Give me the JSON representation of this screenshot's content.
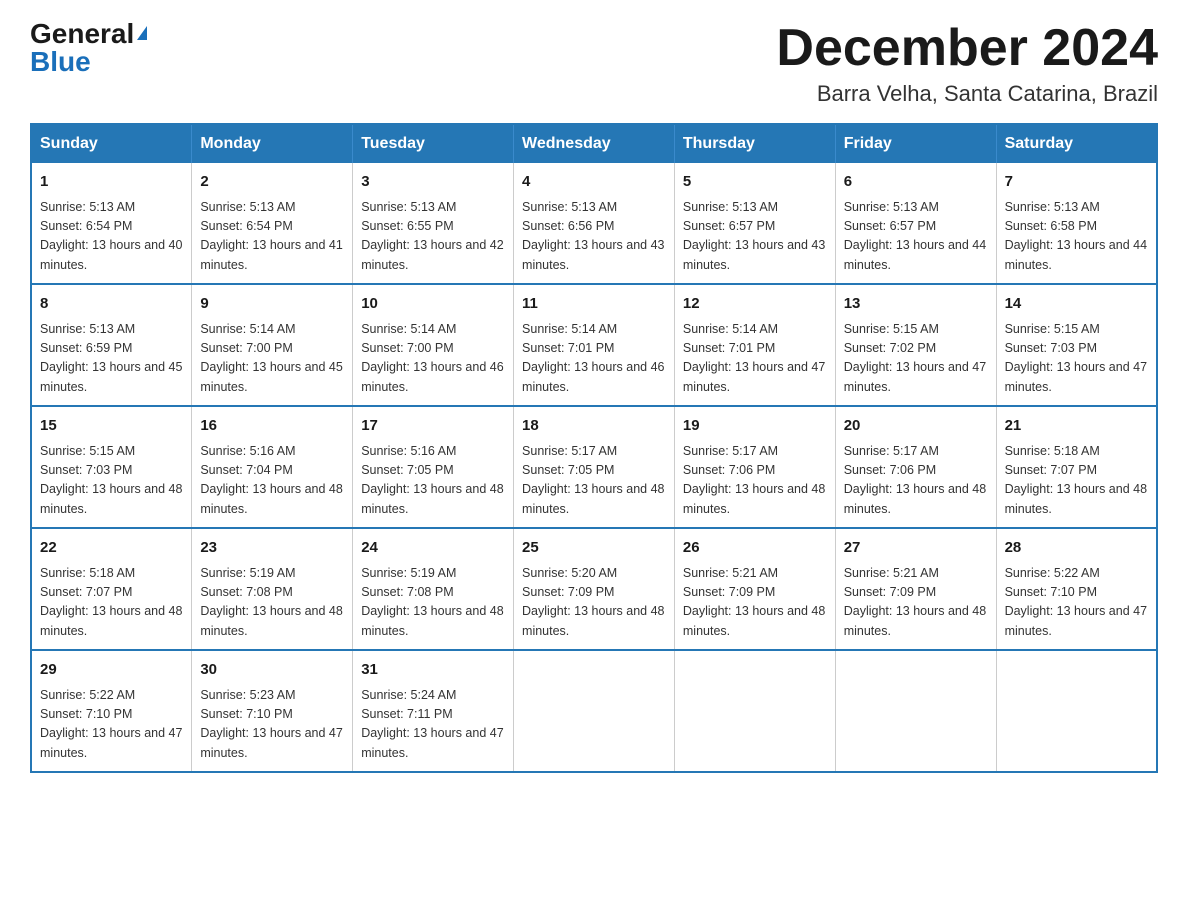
{
  "header": {
    "logo_general": "General",
    "logo_blue": "Blue",
    "month_title": "December 2024",
    "location": "Barra Velha, Santa Catarina, Brazil"
  },
  "days_of_week": [
    "Sunday",
    "Monday",
    "Tuesday",
    "Wednesday",
    "Thursday",
    "Friday",
    "Saturday"
  ],
  "weeks": [
    [
      {
        "day": "1",
        "sunrise": "5:13 AM",
        "sunset": "6:54 PM",
        "daylight": "13 hours and 40 minutes."
      },
      {
        "day": "2",
        "sunrise": "5:13 AM",
        "sunset": "6:54 PM",
        "daylight": "13 hours and 41 minutes."
      },
      {
        "day": "3",
        "sunrise": "5:13 AM",
        "sunset": "6:55 PM",
        "daylight": "13 hours and 42 minutes."
      },
      {
        "day": "4",
        "sunrise": "5:13 AM",
        "sunset": "6:56 PM",
        "daylight": "13 hours and 43 minutes."
      },
      {
        "day": "5",
        "sunrise": "5:13 AM",
        "sunset": "6:57 PM",
        "daylight": "13 hours and 43 minutes."
      },
      {
        "day": "6",
        "sunrise": "5:13 AM",
        "sunset": "6:57 PM",
        "daylight": "13 hours and 44 minutes."
      },
      {
        "day": "7",
        "sunrise": "5:13 AM",
        "sunset": "6:58 PM",
        "daylight": "13 hours and 44 minutes."
      }
    ],
    [
      {
        "day": "8",
        "sunrise": "5:13 AM",
        "sunset": "6:59 PM",
        "daylight": "13 hours and 45 minutes."
      },
      {
        "day": "9",
        "sunrise": "5:14 AM",
        "sunset": "7:00 PM",
        "daylight": "13 hours and 45 minutes."
      },
      {
        "day": "10",
        "sunrise": "5:14 AM",
        "sunset": "7:00 PM",
        "daylight": "13 hours and 46 minutes."
      },
      {
        "day": "11",
        "sunrise": "5:14 AM",
        "sunset": "7:01 PM",
        "daylight": "13 hours and 46 minutes."
      },
      {
        "day": "12",
        "sunrise": "5:14 AM",
        "sunset": "7:01 PM",
        "daylight": "13 hours and 47 minutes."
      },
      {
        "day": "13",
        "sunrise": "5:15 AM",
        "sunset": "7:02 PM",
        "daylight": "13 hours and 47 minutes."
      },
      {
        "day": "14",
        "sunrise": "5:15 AM",
        "sunset": "7:03 PM",
        "daylight": "13 hours and 47 minutes."
      }
    ],
    [
      {
        "day": "15",
        "sunrise": "5:15 AM",
        "sunset": "7:03 PM",
        "daylight": "13 hours and 48 minutes."
      },
      {
        "day": "16",
        "sunrise": "5:16 AM",
        "sunset": "7:04 PM",
        "daylight": "13 hours and 48 minutes."
      },
      {
        "day": "17",
        "sunrise": "5:16 AM",
        "sunset": "7:05 PM",
        "daylight": "13 hours and 48 minutes."
      },
      {
        "day": "18",
        "sunrise": "5:17 AM",
        "sunset": "7:05 PM",
        "daylight": "13 hours and 48 minutes."
      },
      {
        "day": "19",
        "sunrise": "5:17 AM",
        "sunset": "7:06 PM",
        "daylight": "13 hours and 48 minutes."
      },
      {
        "day": "20",
        "sunrise": "5:17 AM",
        "sunset": "7:06 PM",
        "daylight": "13 hours and 48 minutes."
      },
      {
        "day": "21",
        "sunrise": "5:18 AM",
        "sunset": "7:07 PM",
        "daylight": "13 hours and 48 minutes."
      }
    ],
    [
      {
        "day": "22",
        "sunrise": "5:18 AM",
        "sunset": "7:07 PM",
        "daylight": "13 hours and 48 minutes."
      },
      {
        "day": "23",
        "sunrise": "5:19 AM",
        "sunset": "7:08 PM",
        "daylight": "13 hours and 48 minutes."
      },
      {
        "day": "24",
        "sunrise": "5:19 AM",
        "sunset": "7:08 PM",
        "daylight": "13 hours and 48 minutes."
      },
      {
        "day": "25",
        "sunrise": "5:20 AM",
        "sunset": "7:09 PM",
        "daylight": "13 hours and 48 minutes."
      },
      {
        "day": "26",
        "sunrise": "5:21 AM",
        "sunset": "7:09 PM",
        "daylight": "13 hours and 48 minutes."
      },
      {
        "day": "27",
        "sunrise": "5:21 AM",
        "sunset": "7:09 PM",
        "daylight": "13 hours and 48 minutes."
      },
      {
        "day": "28",
        "sunrise": "5:22 AM",
        "sunset": "7:10 PM",
        "daylight": "13 hours and 47 minutes."
      }
    ],
    [
      {
        "day": "29",
        "sunrise": "5:22 AM",
        "sunset": "7:10 PM",
        "daylight": "13 hours and 47 minutes."
      },
      {
        "day": "30",
        "sunrise": "5:23 AM",
        "sunset": "7:10 PM",
        "daylight": "13 hours and 47 minutes."
      },
      {
        "day": "31",
        "sunrise": "5:24 AM",
        "sunset": "7:11 PM",
        "daylight": "13 hours and 47 minutes."
      },
      null,
      null,
      null,
      null
    ]
  ]
}
